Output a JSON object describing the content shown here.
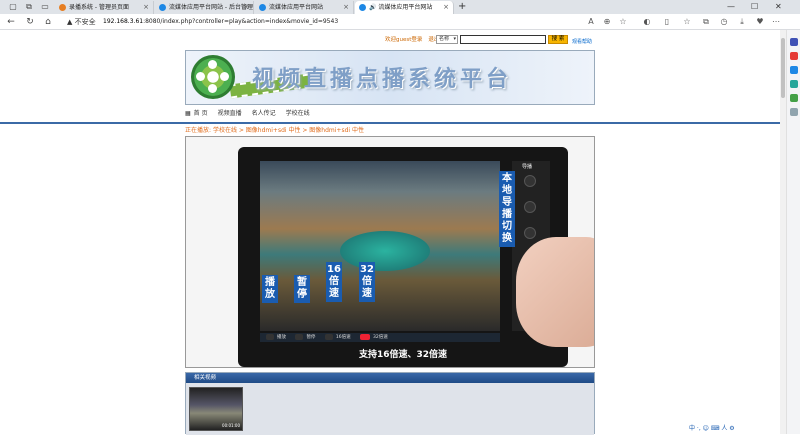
{
  "browser": {
    "tabs": [
      {
        "title": "录播系统 - 管理员页面",
        "active": false,
        "color": "#e67e22"
      },
      {
        "title": "流媒体应用平台网站 - 后台管理",
        "active": false,
        "color": "#1e88e5"
      },
      {
        "title": "流媒体应用平台网站",
        "active": false,
        "color": "#1e88e5"
      },
      {
        "title": "流媒体应用平台网站",
        "active": true,
        "color": "#1e88e5"
      }
    ],
    "security_label": "不安全",
    "url_host": "192.168.3.61",
    "url_rest": ":8080/index.php?controller=play&action=index&movie_id=9543"
  },
  "header": {
    "welcome": "欢迎guest登录",
    "logout": "退出",
    "select_value": "名称",
    "search_value": "",
    "search_button": "搜 索",
    "help": "观看帮助"
  },
  "banner": {
    "title": "视频直播点播系统平台"
  },
  "menu": {
    "items": [
      "首 页",
      "视频直播",
      "名人传记",
      "学校在线"
    ]
  },
  "breadcrumb": {
    "prefix": "正在播放:",
    "path": "学校在线 > 图像hdmi+sdi 中性 > 图像hdmi+sdi 中性"
  },
  "video": {
    "labels_bottom": [
      "播放",
      "暂停",
      "16倍速",
      "32倍速"
    ],
    "label_side": "本地导播切换",
    "caption": "支持16倍速、32倍速",
    "controls": [
      "播放",
      "暂停",
      "16倍速",
      "32倍速"
    ],
    "panel_title": "导播"
  },
  "related": {
    "header": "相关视频",
    "thumb_time": "00:01:00"
  },
  "ime": {
    "text": "中 ·, ☺ ⌨ 人 ⚙"
  }
}
